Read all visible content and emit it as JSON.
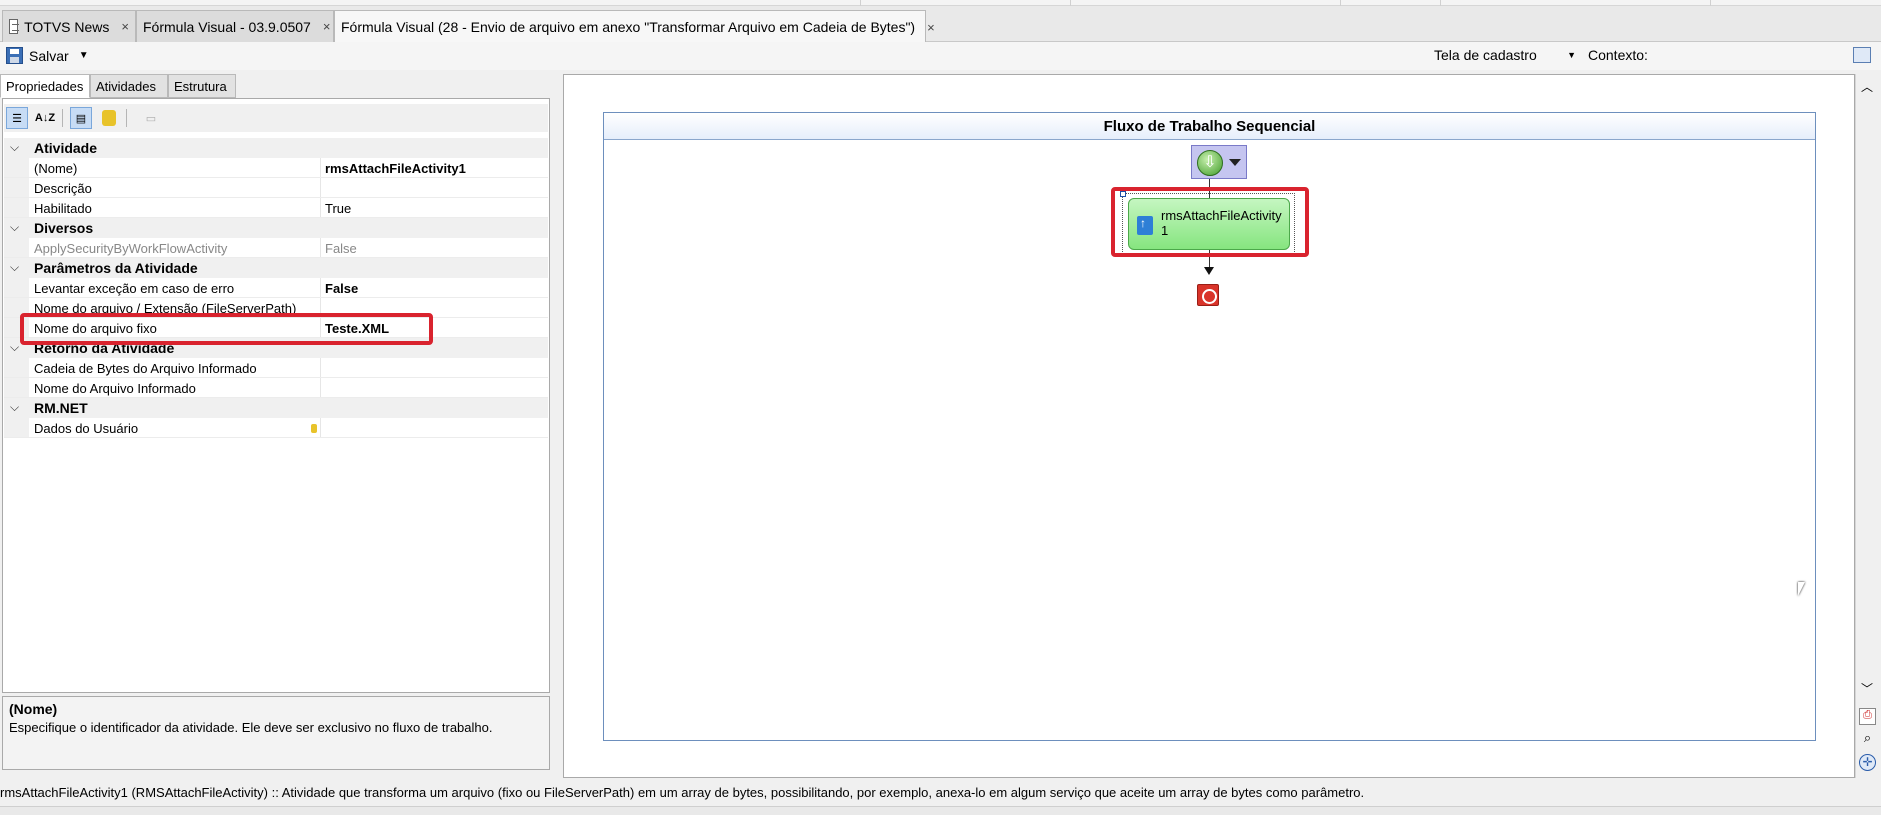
{
  "tabs": [
    {
      "label": "TOTVS News",
      "close": "×"
    },
    {
      "label": "Fórmula Visual - 03.9.0507",
      "close": "×"
    },
    {
      "label": "Fórmula Visual (28 - Envio de arquivo em anexo \"Transformar Arquivo em Cadeia de Bytes\")",
      "close": "×"
    }
  ],
  "toolbar": {
    "save_label": "Salvar",
    "view_select": "Tela de cadastro",
    "context_label": "Contexto:"
  },
  "left_tabs": [
    "Propriedades",
    "Atividades",
    "Estrutura"
  ],
  "grid_tools": {
    "sort_alpha": "A↓Z"
  },
  "properties": {
    "cat_atividade": "Atividade",
    "nome_label": "(Nome)",
    "nome_value": "rmsAttachFileActivity1",
    "descricao_label": "Descrição",
    "habilitado_label": "Habilitado",
    "habilitado_value": "True",
    "cat_diversos": "Diversos",
    "applysec_label": "ApplySecurityByWorkFlowActivity",
    "applysec_value": "False",
    "cat_parametros": "Parâmetros da Atividade",
    "levantar_label": "Levantar exceção em caso de erro",
    "levantar_value": "False",
    "nome_arquivo_ext_label": "Nome do arquivo / Extensão (FileServerPath)",
    "nome_arquivo_fixo_label": "Nome do arquivo fixo",
    "nome_arquivo_fixo_value": "Teste.XML",
    "cat_retorno": "Retorno da Atividade",
    "cadeia_label": "Cadeia de Bytes do Arquivo Informado",
    "nome_informado_label": "Nome do Arquivo Informado",
    "cat_rmnet": "RM.NET",
    "dados_usuario_label": "Dados do Usuário"
  },
  "description": {
    "title": "(Nome)",
    "text": "Especifique o identificador da atividade. Ele deve ser exclusivo no fluxo de trabalho."
  },
  "workflow": {
    "title": "Fluxo de Trabalho Sequencial",
    "activity_label": "rmsAttachFileActivity1"
  },
  "status": "rmsAttachFileActivity1  (RMSAttachFileActivity)  :: Atividade que transforma um arquivo (fixo ou FileServerPath) em um array de bytes, possibilitando, por exemplo, anexa-lo em algum serviço que aceite um array de bytes como parâmetro.",
  "colors": {
    "highlight": "#d9232e",
    "activity_fill": "#86e57f",
    "header_blue": "#e6eefb"
  }
}
